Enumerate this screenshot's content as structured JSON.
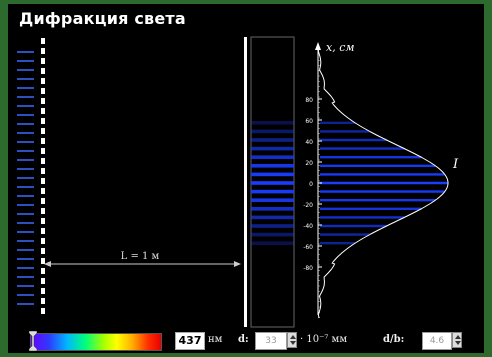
{
  "app": {
    "title": "Дифракция света"
  },
  "distance_label": "L = 1 м",
  "axis": {
    "label": "x, см",
    "intensity_label": "I",
    "ticks": [
      "80",
      "60",
      "40",
      "20",
      "0",
      "-20",
      "-40",
      "-60",
      "-80"
    ]
  },
  "controls": {
    "wavelength": {
      "value": "437",
      "unit": "нм"
    },
    "d": {
      "label": "d:",
      "value": "33",
      "unit": "· 10⁻⁷ мм"
    },
    "db": {
      "label": "d/b:",
      "value": "4.6"
    }
  },
  "colors": {
    "frame": "#2d6a2d",
    "light": "#3a6bff",
    "fringe": "#1a3cff",
    "curve": "#ffffff"
  },
  "icons": [
    "spectrum-marker-icon",
    "stepper-icon"
  ]
}
